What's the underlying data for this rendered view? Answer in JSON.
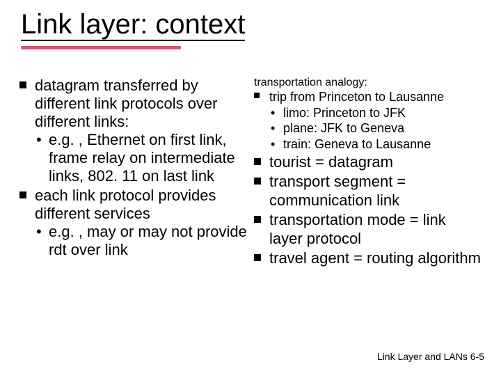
{
  "title": "Link layer: context",
  "left": {
    "b1": {
      "text": "datagram transferred by different link protocols over different links:",
      "sub1": "e.g. , Ethernet on first link, frame relay on intermediate links, 802. 11 on last link"
    },
    "b2": {
      "text": "each  link protocol provides different services",
      "sub1": "e.g. , may or may not provide rdt over link"
    }
  },
  "right": {
    "heading": "transportation analogy:",
    "trip": {
      "text": "trip from Princeton to Lausanne",
      "s1": "limo: Princeton to JFK",
      "s2": "plane: JFK to Geneva",
      "s3": "train: Geneva to Lausanne"
    },
    "a1": "tourist = datagram",
    "a2": "transport segment = communication link",
    "a3": "transportation mode = link layer protocol",
    "a4": "travel agent = routing algorithm"
  },
  "footer": "Link Layer and LANs  6-5"
}
